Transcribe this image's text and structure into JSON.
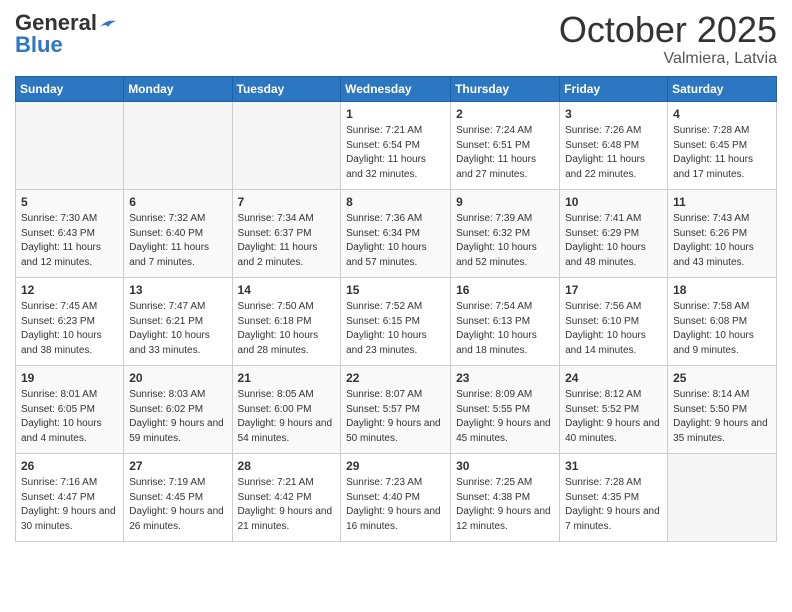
{
  "header": {
    "logo_general": "General",
    "logo_blue": "Blue",
    "month": "October 2025",
    "location": "Valmiera, Latvia"
  },
  "weekdays": [
    "Sunday",
    "Monday",
    "Tuesday",
    "Wednesday",
    "Thursday",
    "Friday",
    "Saturday"
  ],
  "weeks": [
    [
      {
        "day": "",
        "sunrise": "",
        "sunset": "",
        "daylight": ""
      },
      {
        "day": "",
        "sunrise": "",
        "sunset": "",
        "daylight": ""
      },
      {
        "day": "",
        "sunrise": "",
        "sunset": "",
        "daylight": ""
      },
      {
        "day": "1",
        "sunrise": "Sunrise: 7:21 AM",
        "sunset": "Sunset: 6:54 PM",
        "daylight": "Daylight: 11 hours and 32 minutes."
      },
      {
        "day": "2",
        "sunrise": "Sunrise: 7:24 AM",
        "sunset": "Sunset: 6:51 PM",
        "daylight": "Daylight: 11 hours and 27 minutes."
      },
      {
        "day": "3",
        "sunrise": "Sunrise: 7:26 AM",
        "sunset": "Sunset: 6:48 PM",
        "daylight": "Daylight: 11 hours and 22 minutes."
      },
      {
        "day": "4",
        "sunrise": "Sunrise: 7:28 AM",
        "sunset": "Sunset: 6:45 PM",
        "daylight": "Daylight: 11 hours and 17 minutes."
      }
    ],
    [
      {
        "day": "5",
        "sunrise": "Sunrise: 7:30 AM",
        "sunset": "Sunset: 6:43 PM",
        "daylight": "Daylight: 11 hours and 12 minutes."
      },
      {
        "day": "6",
        "sunrise": "Sunrise: 7:32 AM",
        "sunset": "Sunset: 6:40 PM",
        "daylight": "Daylight: 11 hours and 7 minutes."
      },
      {
        "day": "7",
        "sunrise": "Sunrise: 7:34 AM",
        "sunset": "Sunset: 6:37 PM",
        "daylight": "Daylight: 11 hours and 2 minutes."
      },
      {
        "day": "8",
        "sunrise": "Sunrise: 7:36 AM",
        "sunset": "Sunset: 6:34 PM",
        "daylight": "Daylight: 10 hours and 57 minutes."
      },
      {
        "day": "9",
        "sunrise": "Sunrise: 7:39 AM",
        "sunset": "Sunset: 6:32 PM",
        "daylight": "Daylight: 10 hours and 52 minutes."
      },
      {
        "day": "10",
        "sunrise": "Sunrise: 7:41 AM",
        "sunset": "Sunset: 6:29 PM",
        "daylight": "Daylight: 10 hours and 48 minutes."
      },
      {
        "day": "11",
        "sunrise": "Sunrise: 7:43 AM",
        "sunset": "Sunset: 6:26 PM",
        "daylight": "Daylight: 10 hours and 43 minutes."
      }
    ],
    [
      {
        "day": "12",
        "sunrise": "Sunrise: 7:45 AM",
        "sunset": "Sunset: 6:23 PM",
        "daylight": "Daylight: 10 hours and 38 minutes."
      },
      {
        "day": "13",
        "sunrise": "Sunrise: 7:47 AM",
        "sunset": "Sunset: 6:21 PM",
        "daylight": "Daylight: 10 hours and 33 minutes."
      },
      {
        "day": "14",
        "sunrise": "Sunrise: 7:50 AM",
        "sunset": "Sunset: 6:18 PM",
        "daylight": "Daylight: 10 hours and 28 minutes."
      },
      {
        "day": "15",
        "sunrise": "Sunrise: 7:52 AM",
        "sunset": "Sunset: 6:15 PM",
        "daylight": "Daylight: 10 hours and 23 minutes."
      },
      {
        "day": "16",
        "sunrise": "Sunrise: 7:54 AM",
        "sunset": "Sunset: 6:13 PM",
        "daylight": "Daylight: 10 hours and 18 minutes."
      },
      {
        "day": "17",
        "sunrise": "Sunrise: 7:56 AM",
        "sunset": "Sunset: 6:10 PM",
        "daylight": "Daylight: 10 hours and 14 minutes."
      },
      {
        "day": "18",
        "sunrise": "Sunrise: 7:58 AM",
        "sunset": "Sunset: 6:08 PM",
        "daylight": "Daylight: 10 hours and 9 minutes."
      }
    ],
    [
      {
        "day": "19",
        "sunrise": "Sunrise: 8:01 AM",
        "sunset": "Sunset: 6:05 PM",
        "daylight": "Daylight: 10 hours and 4 minutes."
      },
      {
        "day": "20",
        "sunrise": "Sunrise: 8:03 AM",
        "sunset": "Sunset: 6:02 PM",
        "daylight": "Daylight: 9 hours and 59 minutes."
      },
      {
        "day": "21",
        "sunrise": "Sunrise: 8:05 AM",
        "sunset": "Sunset: 6:00 PM",
        "daylight": "Daylight: 9 hours and 54 minutes."
      },
      {
        "day": "22",
        "sunrise": "Sunrise: 8:07 AM",
        "sunset": "Sunset: 5:57 PM",
        "daylight": "Daylight: 9 hours and 50 minutes."
      },
      {
        "day": "23",
        "sunrise": "Sunrise: 8:09 AM",
        "sunset": "Sunset: 5:55 PM",
        "daylight": "Daylight: 9 hours and 45 minutes."
      },
      {
        "day": "24",
        "sunrise": "Sunrise: 8:12 AM",
        "sunset": "Sunset: 5:52 PM",
        "daylight": "Daylight: 9 hours and 40 minutes."
      },
      {
        "day": "25",
        "sunrise": "Sunrise: 8:14 AM",
        "sunset": "Sunset: 5:50 PM",
        "daylight": "Daylight: 9 hours and 35 minutes."
      }
    ],
    [
      {
        "day": "26",
        "sunrise": "Sunrise: 7:16 AM",
        "sunset": "Sunset: 4:47 PM",
        "daylight": "Daylight: 9 hours and 30 minutes."
      },
      {
        "day": "27",
        "sunrise": "Sunrise: 7:19 AM",
        "sunset": "Sunset: 4:45 PM",
        "daylight": "Daylight: 9 hours and 26 minutes."
      },
      {
        "day": "28",
        "sunrise": "Sunrise: 7:21 AM",
        "sunset": "Sunset: 4:42 PM",
        "daylight": "Daylight: 9 hours and 21 minutes."
      },
      {
        "day": "29",
        "sunrise": "Sunrise: 7:23 AM",
        "sunset": "Sunset: 4:40 PM",
        "daylight": "Daylight: 9 hours and 16 minutes."
      },
      {
        "day": "30",
        "sunrise": "Sunrise: 7:25 AM",
        "sunset": "Sunset: 4:38 PM",
        "daylight": "Daylight: 9 hours and 12 minutes."
      },
      {
        "day": "31",
        "sunrise": "Sunrise: 7:28 AM",
        "sunset": "Sunset: 4:35 PM",
        "daylight": "Daylight: 9 hours and 7 minutes."
      },
      {
        "day": "",
        "sunrise": "",
        "sunset": "",
        "daylight": ""
      }
    ]
  ]
}
